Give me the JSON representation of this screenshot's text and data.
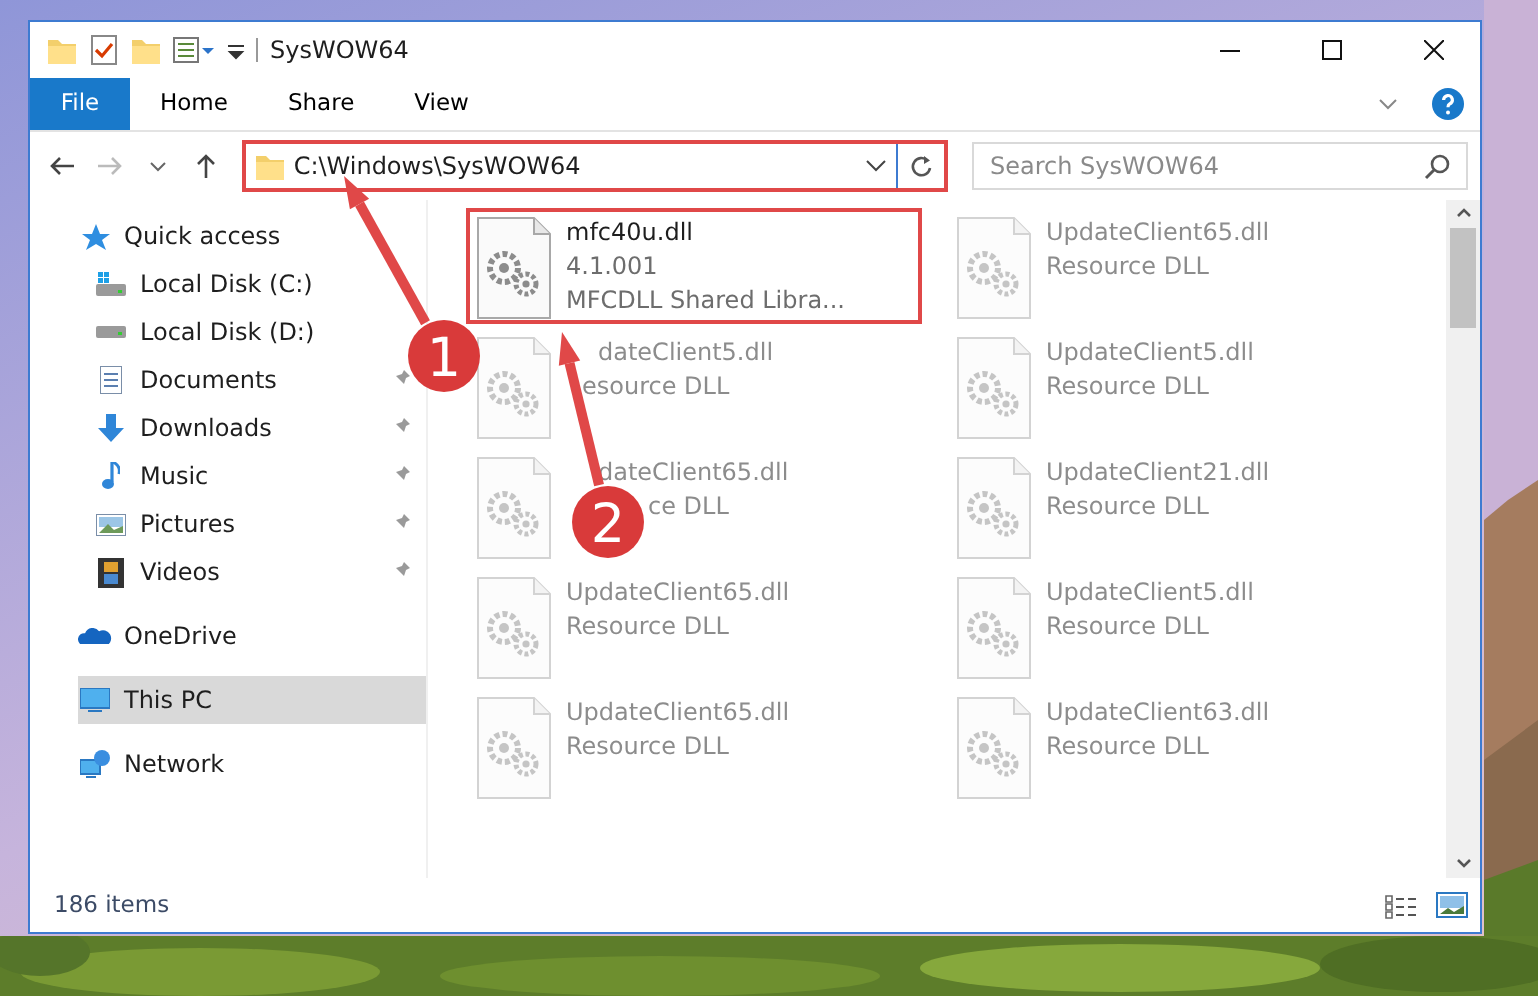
{
  "window": {
    "title": "SysWOW64"
  },
  "ribbon": {
    "tabs": [
      {
        "label": "File",
        "kind": "file"
      },
      {
        "label": "Home",
        "kind": "plain"
      },
      {
        "label": "Share",
        "kind": "plain"
      },
      {
        "label": "View",
        "kind": "plain"
      }
    ]
  },
  "address_bar": {
    "path": "C:\\Windows\\SysWOW64",
    "highlighted": true
  },
  "search": {
    "placeholder": "Search SysWOW64"
  },
  "sidebar": {
    "items": [
      {
        "label": "Quick access",
        "kind": "star",
        "selected": false,
        "children": [
          {
            "label": "Local Disk (C:)",
            "kind": "windisk",
            "pinned": false,
            "selected": false
          },
          {
            "label": "Local Disk (D:)",
            "kind": "disk",
            "pinned": false,
            "selected": false
          },
          {
            "label": "Documents",
            "kind": "document",
            "pinned": true,
            "selected": false
          },
          {
            "label": "Downloads",
            "kind": "download",
            "pinned": true,
            "selected": false
          },
          {
            "label": "Music",
            "kind": "music",
            "pinned": true,
            "selected": false
          },
          {
            "label": "Pictures",
            "kind": "pictures",
            "pinned": true,
            "selected": false
          },
          {
            "label": "Videos",
            "kind": "videos",
            "pinned": true,
            "selected": false
          }
        ]
      },
      {
        "label": "OneDrive",
        "kind": "cloud",
        "selected": false
      },
      {
        "label": "This PC",
        "kind": "pc",
        "selected": true
      },
      {
        "label": "Network",
        "kind": "network",
        "selected": false
      }
    ]
  },
  "files": [
    {
      "name": "mfc40u.dll",
      "details": [
        "4.1.001",
        "MFCDLL Shared Libra..."
      ],
      "highlighted": true
    },
    {
      "name": "UpdateClient65.dll",
      "details": [
        "Resource DLL"
      ],
      "highlighted": false
    },
    {
      "name": "dateClient5.dll",
      "details": [
        "esource DLL"
      ],
      "highlighted": false
    },
    {
      "name": "UpdateClient5.dll",
      "details": [
        "Resource DLL"
      ],
      "highlighted": false
    },
    {
      "name": "dateClient65.dll",
      "details": [
        "ce DLL"
      ],
      "highlighted": false
    },
    {
      "name": "UpdateClient21.dll",
      "details": [
        "Resource DLL"
      ],
      "highlighted": false
    },
    {
      "name": "UpdateClient65.dll",
      "details": [
        "Resource DLL"
      ],
      "highlighted": false
    },
    {
      "name": "UpdateClient5.dll",
      "details": [
        "Resource DLL"
      ],
      "highlighted": false
    },
    {
      "name": "UpdateClient65.dll",
      "details": [
        "Resource DLL"
      ],
      "highlighted": false
    },
    {
      "name": "UpdateClient63.dll",
      "details": [
        "Resource DLL"
      ],
      "highlighted": false
    }
  ],
  "status_bar": {
    "item_count": "186 items"
  },
  "annotations": [
    {
      "label": "1"
    },
    {
      "label": "2"
    }
  ]
}
